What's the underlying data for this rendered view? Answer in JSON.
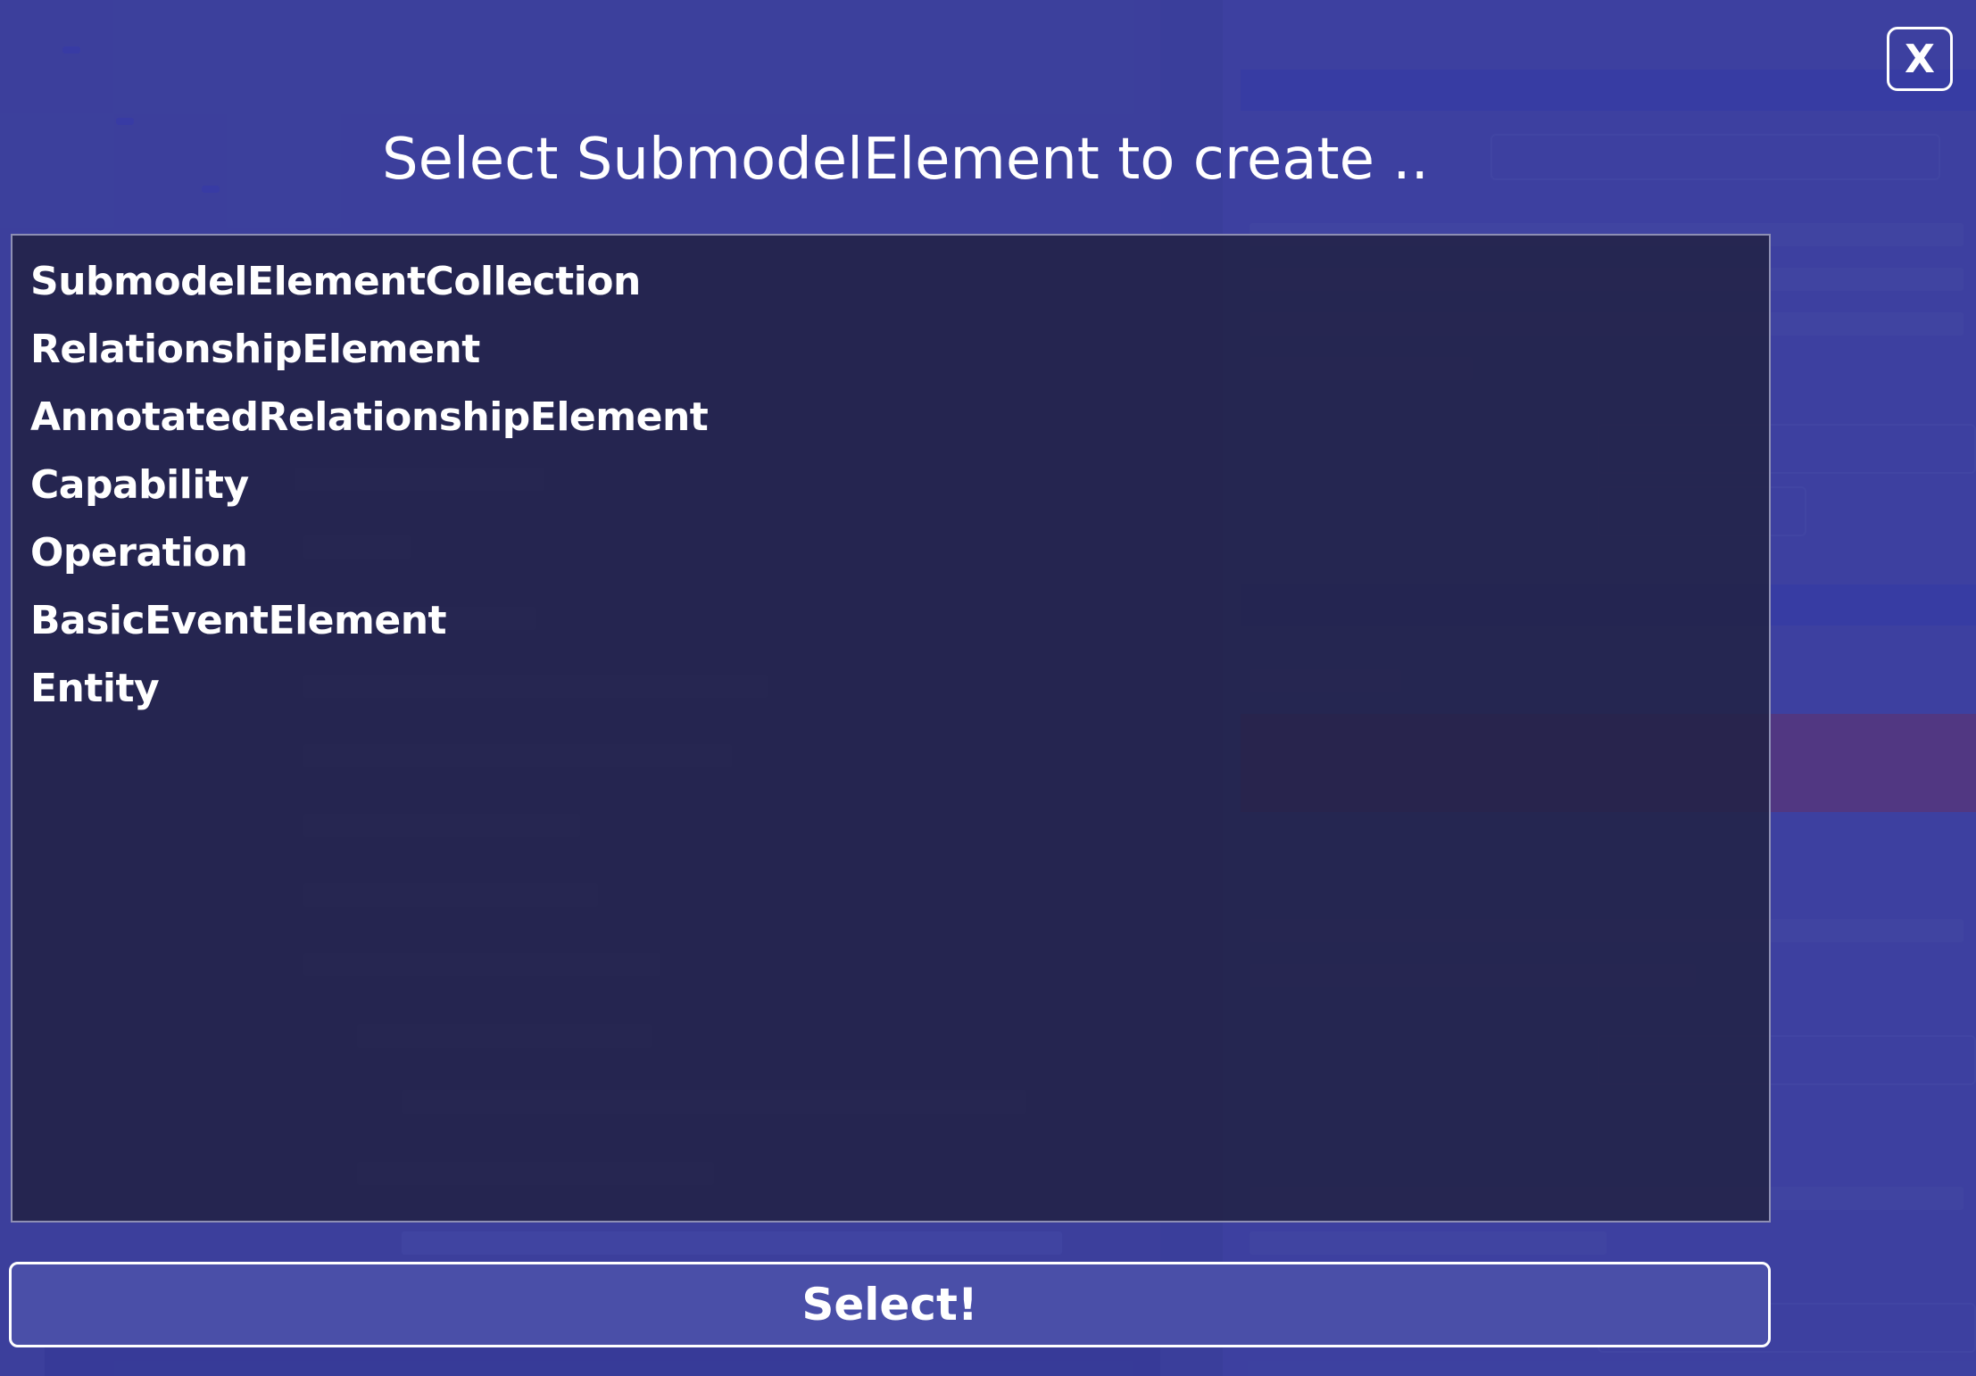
{
  "dialog": {
    "title": "Select SubmodelElement to create ..",
    "close_label": "X",
    "items": [
      {
        "label": "SubmodelElementCollection"
      },
      {
        "label": "RelationshipElement"
      },
      {
        "label": "AnnotatedRelationshipElement"
      },
      {
        "label": "Capability"
      },
      {
        "label": "Operation"
      },
      {
        "label": "BasicEventElement"
      },
      {
        "label": "Entity"
      }
    ],
    "select_label": "Select!"
  },
  "colors": {
    "overlay": "#3a3ea0",
    "list_background": "#222246",
    "text": "#ffffff",
    "button_background": "#4a4fa8"
  }
}
